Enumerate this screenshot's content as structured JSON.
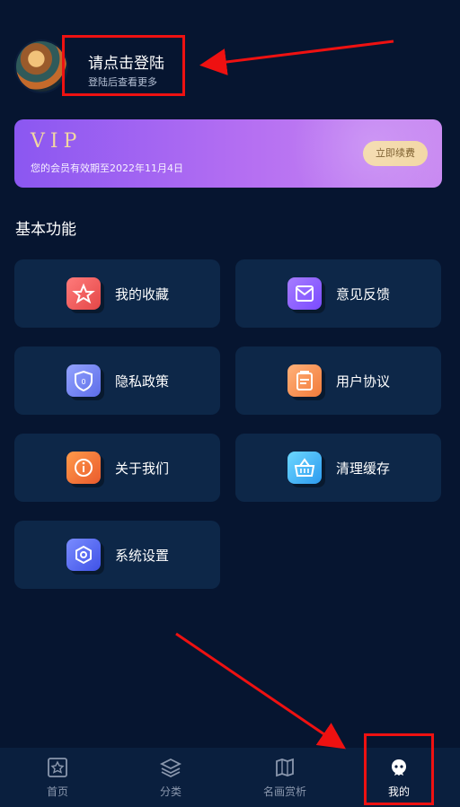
{
  "profile": {
    "login_title": "请点击登陆",
    "login_subtitle": "登陆后查看更多"
  },
  "vip": {
    "title": "VIP",
    "subtitle": "您的会员有效期至2022年11月4日",
    "renew_label": "立即续费"
  },
  "section": {
    "title": "基本功能"
  },
  "features": [
    {
      "label": "我的收藏",
      "icon": "star-icon",
      "color": "#e44747"
    },
    {
      "label": "意见反馈",
      "icon": "mail-icon",
      "color": "#7a4bff"
    },
    {
      "label": "隐私政策",
      "icon": "shield-icon",
      "color": "#5d6de8"
    },
    {
      "label": "用户协议",
      "icon": "clipboard-icon",
      "color": "#f27b3a"
    },
    {
      "label": "关于我们",
      "icon": "info-icon",
      "color": "#ea5b2d"
    },
    {
      "label": "清理缓存",
      "icon": "basket-icon",
      "color": "#2d9bef"
    },
    {
      "label": "系统设置",
      "icon": "settings-icon",
      "color": "#3f52e6"
    }
  ],
  "tabs": [
    {
      "label": "首页",
      "icon": "home-icon",
      "active": false
    },
    {
      "label": "分类",
      "icon": "layers-icon",
      "active": false
    },
    {
      "label": "名画赏析",
      "icon": "map-icon",
      "active": false
    },
    {
      "label": "我的",
      "icon": "profile-icon",
      "active": true
    }
  ],
  "colors": {
    "background": "#061530",
    "tile_background": "#0d2748",
    "vip_gradient_start": "#8b57f1",
    "vip_gradient_end": "#c98af2",
    "highlight_red": "#ee1111"
  }
}
